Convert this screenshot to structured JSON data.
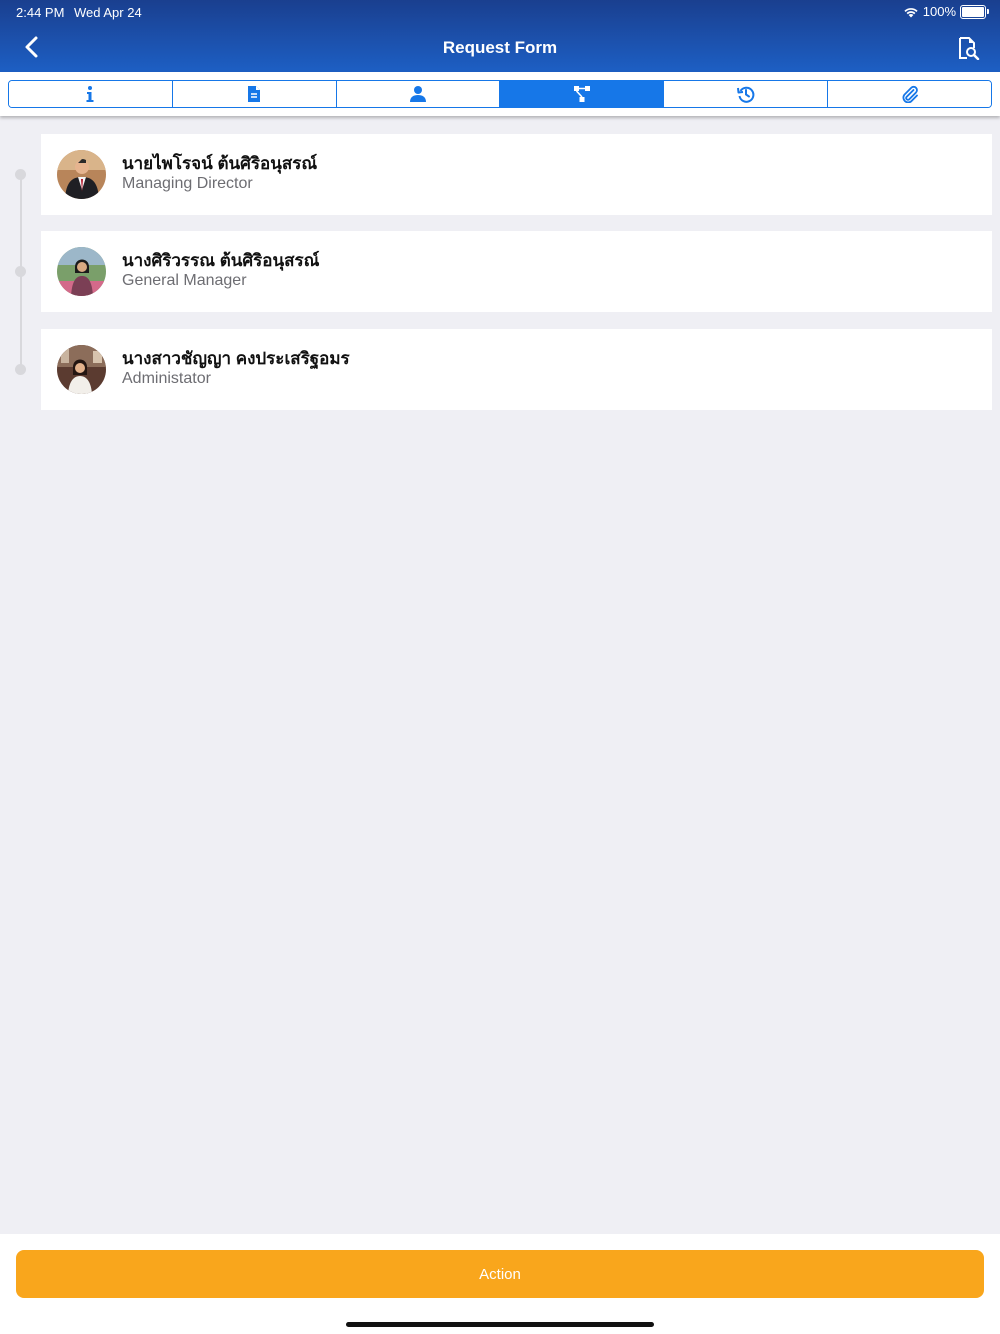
{
  "status_bar": {
    "time": "2:44 PM",
    "date": "Wed Apr 24",
    "battery": "100%"
  },
  "header": {
    "title": "Request Form"
  },
  "tabs": [
    {
      "icon": "info-icon",
      "active": false
    },
    {
      "icon": "document-icon",
      "active": false
    },
    {
      "icon": "user-icon",
      "active": false
    },
    {
      "icon": "flow-icon",
      "active": true
    },
    {
      "icon": "history-icon",
      "active": false
    },
    {
      "icon": "paperclip-icon",
      "active": false
    }
  ],
  "approvers": [
    {
      "name": "นายไพโรจน์ ต้นศิริอนุสรณ์",
      "role": "Managing Director"
    },
    {
      "name": "นางศิริวรรณ  ต้นศิริอนุสรณ์",
      "role": "General Manager"
    },
    {
      "name": "นางสาวชัญญา คงประเสริฐอมร",
      "role": "Administator"
    }
  ],
  "action": {
    "label": "Action"
  },
  "colors": {
    "header": "#1d5fc4",
    "accent": "#1677e8",
    "action": "#f9a61c"
  }
}
